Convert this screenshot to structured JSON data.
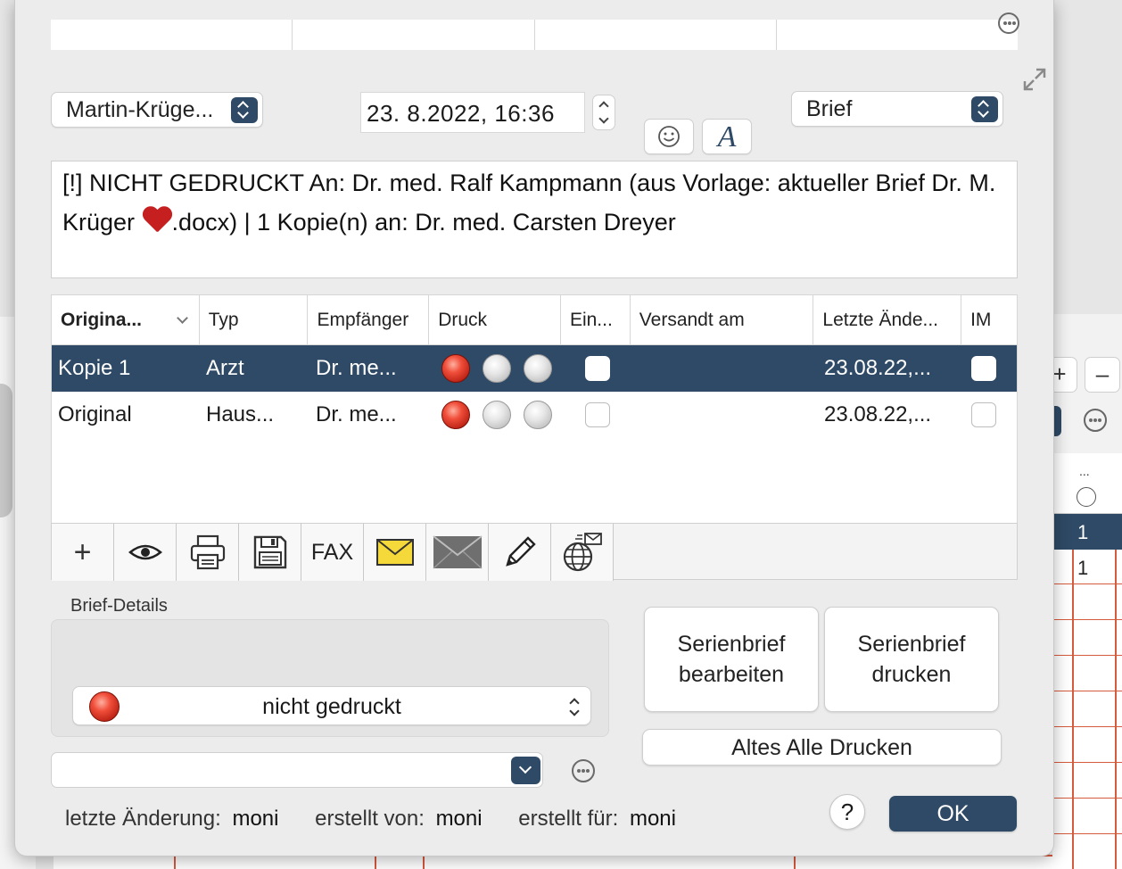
{
  "background": {
    "plus_label": "+",
    "minus_label": "–",
    "grid_header_dots": "...",
    "grid_cells": [
      "1",
      "1"
    ]
  },
  "header": {
    "author": "Martin-Krüge...",
    "date": "23.  8.2022, 16:36",
    "document_type": "Brief",
    "font_button_label": "A"
  },
  "description": {
    "before_heart": "[!] NICHT GEDRUCKT An:  Dr. med. Ralf Kampmann (aus Vorlage: aktueller Brief Dr. M. Krüger ",
    "after_heart": ".docx) | 1 Kopie(n) an: Dr. med. Carsten Dreyer"
  },
  "table": {
    "columns": [
      "Origina...",
      "Typ",
      "Empfänger",
      "Druck",
      "Ein...",
      "Versandt am",
      "Letzte Ände...",
      "IM"
    ],
    "rows": [
      {
        "original": "Kopie 1",
        "typ": "Arzt",
        "empfaenger": "Dr. me...",
        "druck": [
          "red",
          "off",
          "off"
        ],
        "versandt": "",
        "letzte": "23.08.22,...",
        "selected": true
      },
      {
        "original": "Original",
        "typ": "Haus...",
        "empfaenger": "Dr. me...",
        "druck": [
          "red",
          "off",
          "off"
        ],
        "versandt": "",
        "letzte": "23.08.22,...",
        "selected": false
      }
    ]
  },
  "toolbar": {
    "add_label": "+",
    "fax_label": "FAX"
  },
  "details": {
    "label": "Brief-Details",
    "print_status": "nicht gedruckt"
  },
  "buttons": {
    "serial_edit": "Serienbrief\nbearbeiten",
    "serial_print": "Serienbrief\ndrucken",
    "print_all_old": "Altes Alle Drucken",
    "help": "?",
    "ok": "OK"
  },
  "footer": {
    "last_change_label": "letzte Änderung:",
    "last_change_value": "moni",
    "created_by_label": "erstellt von:",
    "created_by_value": "moni",
    "created_for_label": "erstellt für:",
    "created_for_value": "moni"
  },
  "colors": {
    "accent": "#2f4a66",
    "status_red": "#e03a2a",
    "grid_red": "#d65a3e"
  }
}
